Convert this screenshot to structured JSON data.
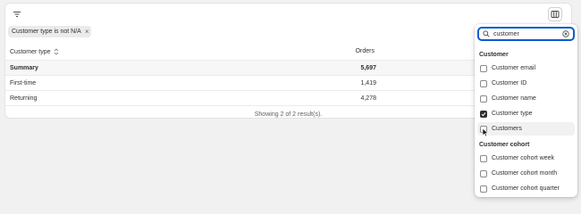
{
  "filter_chip": {
    "label": "Customer type is not N/A",
    "remove_glyph": "×"
  },
  "table": {
    "headers": {
      "col1": "Customer type",
      "col2": "Orders"
    },
    "rows": [
      {
        "label": "Summary",
        "value": "5,697",
        "summary": true
      },
      {
        "label": "First-time",
        "value": "1,419"
      },
      {
        "label": "Returning",
        "value": "4,278"
      }
    ],
    "footer": "Showing 2 of 2 result(s)."
  },
  "popover": {
    "search_value": "customer",
    "sections": [
      {
        "title": "Customer",
        "options": [
          {
            "label": "Customer email",
            "checked": false
          },
          {
            "label": "Customer ID",
            "checked": false
          },
          {
            "label": "Customer name",
            "checked": false
          },
          {
            "label": "Customer type",
            "checked": true
          },
          {
            "label": "Customers",
            "checked": false,
            "hover": true
          }
        ]
      },
      {
        "title": "Customer cohort",
        "options": [
          {
            "label": "Customer cohort week",
            "checked": false
          },
          {
            "label": "Customer cohort month",
            "checked": false
          },
          {
            "label": "Customer cohort quarter",
            "checked": false
          }
        ]
      }
    ]
  },
  "icons": {
    "filter": "filter-icon",
    "columns": "columns-icon",
    "sort": "sort-icon",
    "search": "search-icon",
    "clear": "clear-icon",
    "check": "check-icon"
  },
  "colors": {
    "accent": "#005bd3",
    "checked": "#303030",
    "background": "#f1f1f1"
  }
}
